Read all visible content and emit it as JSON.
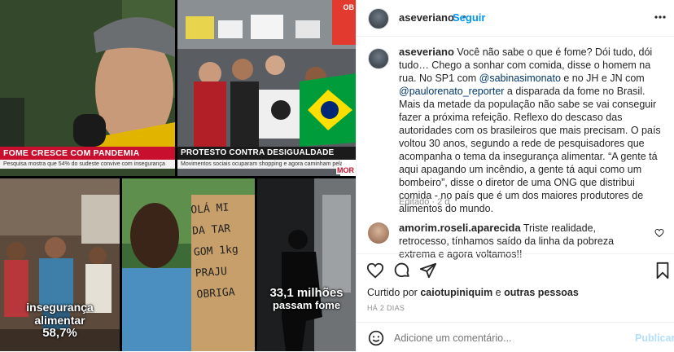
{
  "media": {
    "tile1": {
      "banner": "FOME CRESCE COM PANDEMIA",
      "subtitle": "Pesquisa mostra que 54% do sudeste convive com insegurança"
    },
    "tile2": {
      "banner": "PROTESTO CONTRA DESIGUALDADE",
      "subtitle": "Movimentos sociais ocuparam shopping e agora caminham pela",
      "sign_fragment": "MOR",
      "sign_top": "OB"
    },
    "tile3": {
      "caption_line1": "insegurança alimentar",
      "caption_line2": "58,7%"
    },
    "tile4": {
      "sign_lines": [
        "OLÁ MI",
        "DA TAR",
        "GOM 1kg",
        "PRAJU",
        "OBRIGA"
      ]
    },
    "tile5": {
      "caption_line1": "33,1 milhões",
      "caption_line2": "passam fome"
    }
  },
  "header": {
    "username": "aseveriano",
    "separator": "•",
    "follow_label": "Seguir",
    "more_icon": "more-horizontal-icon"
  },
  "post": {
    "username": "aseveriano",
    "caption_parts": {
      "p1": "Você não sabe o que é fome? Dói tudo, dói tudo… Chego a sonhar com comida, disse o homem na rua. No SP1 com ",
      "mention1": "@sabinasimonato",
      "p2": " e no JH e JN com ",
      "mention2": "@paulorenato_reporter",
      "p3": " a disparada da fome no Brasil. Mais da metade da população não sabe se vai conseguir fazer a próxima refeição. Reflexo do descaso das autoridades com os brasileiros que mais precisam. O país voltou 30 anos, segundo a rede de pesquisadores que acompanha o tema da insegurança alimentar. “A gente tá aqui apagando um incêndio, a gente tá aqui como um bombeiro”, disse o diretor de uma ONG que distribui comida - no país que é um dos maiores produtores de alimentos do mundo."
    },
    "edited": "Editado",
    "edited_sep": "·",
    "edited_time": "2 d"
  },
  "comment": {
    "username": "amorim.roseli.aparecida",
    "text": "Triste realidade, retrocesso, tínhamos saído da linha da pobreza extrema e agora voltamos!!"
  },
  "actions": {
    "icons": [
      "heart-icon",
      "comment-icon",
      "share-icon",
      "bookmark-icon"
    ]
  },
  "likes": {
    "prefix": "Curtido por ",
    "user": "caiotupiniquim",
    "middle": " e ",
    "others": "outras pessoas"
  },
  "timestamp": "HÁ 2 DIAS",
  "add_comment": {
    "placeholder": "Adicione um comentário...",
    "publish_label": "Publicar",
    "emoji_icon": "emoji-icon"
  },
  "colors": {
    "accent": "#0095f6",
    "publish_disabled": "#b2dffc",
    "banner_red": "#c8102e",
    "link": "#00376b"
  }
}
